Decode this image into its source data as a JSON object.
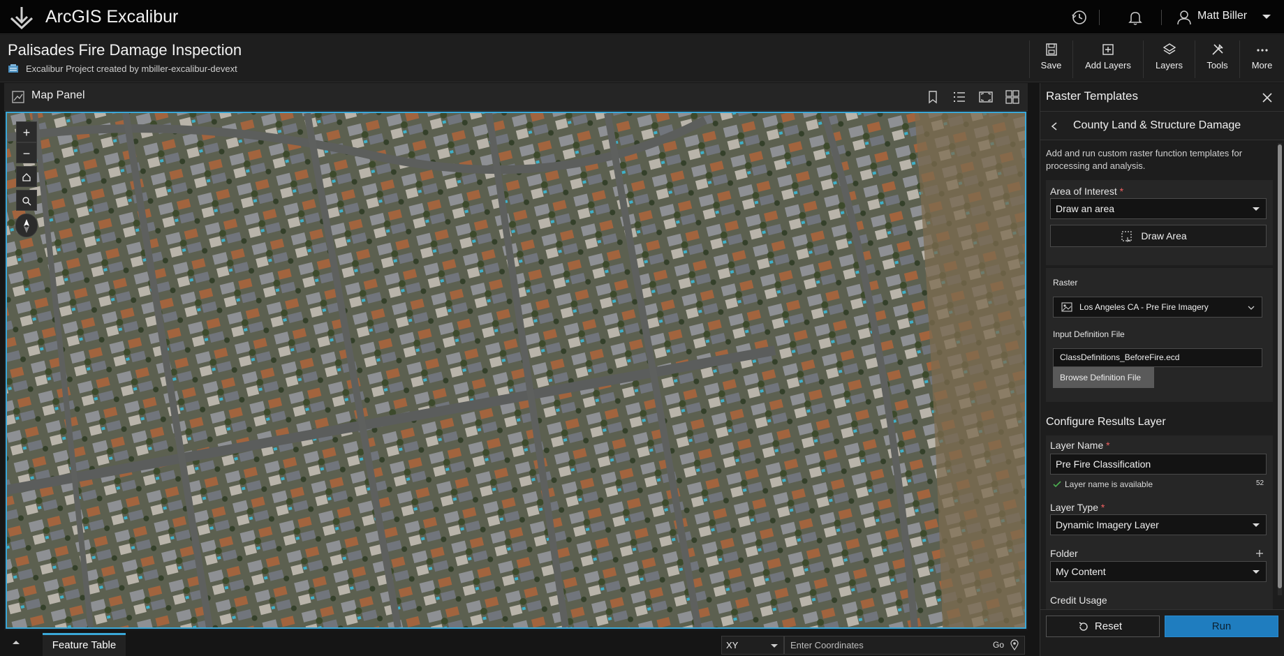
{
  "app": {
    "title": "ArcGIS Excalibur",
    "user": "Matt Biller"
  },
  "topbar_icons": [
    "history-icon",
    "bell-icon",
    "user-icon",
    "caret-down-icon"
  ],
  "project": {
    "title": "Palisades Fire Damage Inspection",
    "subtitle": "Excalibur Project created by mbiller-excalibur-devext"
  },
  "toolbar": {
    "save": "Save",
    "add_layers": "Add Layers",
    "layers": "Layers",
    "tools": "Tools",
    "more": "More"
  },
  "map_panel": {
    "title": "Map Panel",
    "controls": {
      "zoom_in": "+",
      "zoom_out": "−"
    }
  },
  "bottom": {
    "feature_table_tab": "Feature Table",
    "coord_format": "XY",
    "coord_placeholder": "Enter Coordinates",
    "go": "Go"
  },
  "right_panel": {
    "title": "Raster Templates",
    "subtitle": "County Land & Structure Damage",
    "description": "Add and run custom raster function templates for processing and analysis.",
    "area_of_interest": {
      "label": "Area of Interest",
      "value": "Draw an area",
      "button": "Draw Area"
    },
    "raster": {
      "label": "Raster",
      "value": "Los Angeles CA - Pre Fire Imagery"
    },
    "input_def": {
      "label": "Input Definition File",
      "value": "ClassDefinitions_BeforeFire.ecd",
      "button": "Browse Definition File"
    },
    "configure_heading": "Configure Results Layer",
    "layer_name": {
      "label": "Layer Name",
      "value": "Pre Fire Classification",
      "status": "Layer name is available",
      "count": "52"
    },
    "layer_type": {
      "label": "Layer Type",
      "value": "Dynamic Imagery Layer"
    },
    "folder": {
      "label": "Folder",
      "value": "My Content"
    },
    "credit_usage": {
      "label": "Credit Usage"
    },
    "reset": "Reset",
    "run": "Run"
  },
  "colors": {
    "accent": "#3aa7d8",
    "run": "#1f7dbf",
    "required": "#f06060",
    "ok": "#4caf50"
  }
}
